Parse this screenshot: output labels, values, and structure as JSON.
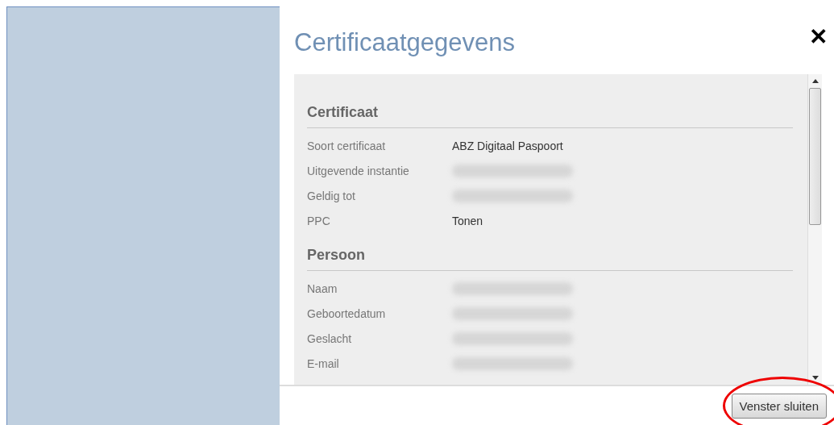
{
  "dialog": {
    "title": "Certificaatgegevens",
    "close_glyph": "✕"
  },
  "sections": [
    {
      "heading": "Certificaat",
      "rows": [
        {
          "label": "Soort certificaat",
          "value": "ABZ Digitaal Paspoort",
          "redacted": false
        },
        {
          "label": "Uitgevende instantie",
          "redacted": true
        },
        {
          "label": "Geldig tot",
          "redacted": true
        },
        {
          "label": "PPC",
          "value": "Tonen",
          "redacted": false
        }
      ]
    },
    {
      "heading": "Persoon",
      "rows": [
        {
          "label": "Naam",
          "redacted": true
        },
        {
          "label": "Geboortedatum",
          "redacted": true
        },
        {
          "label": "Geslacht",
          "redacted": true
        },
        {
          "label": "E-mail",
          "redacted": true
        }
      ]
    }
  ],
  "footer_button": {
    "label": "Venster sluiten",
    "circled": true
  }
}
